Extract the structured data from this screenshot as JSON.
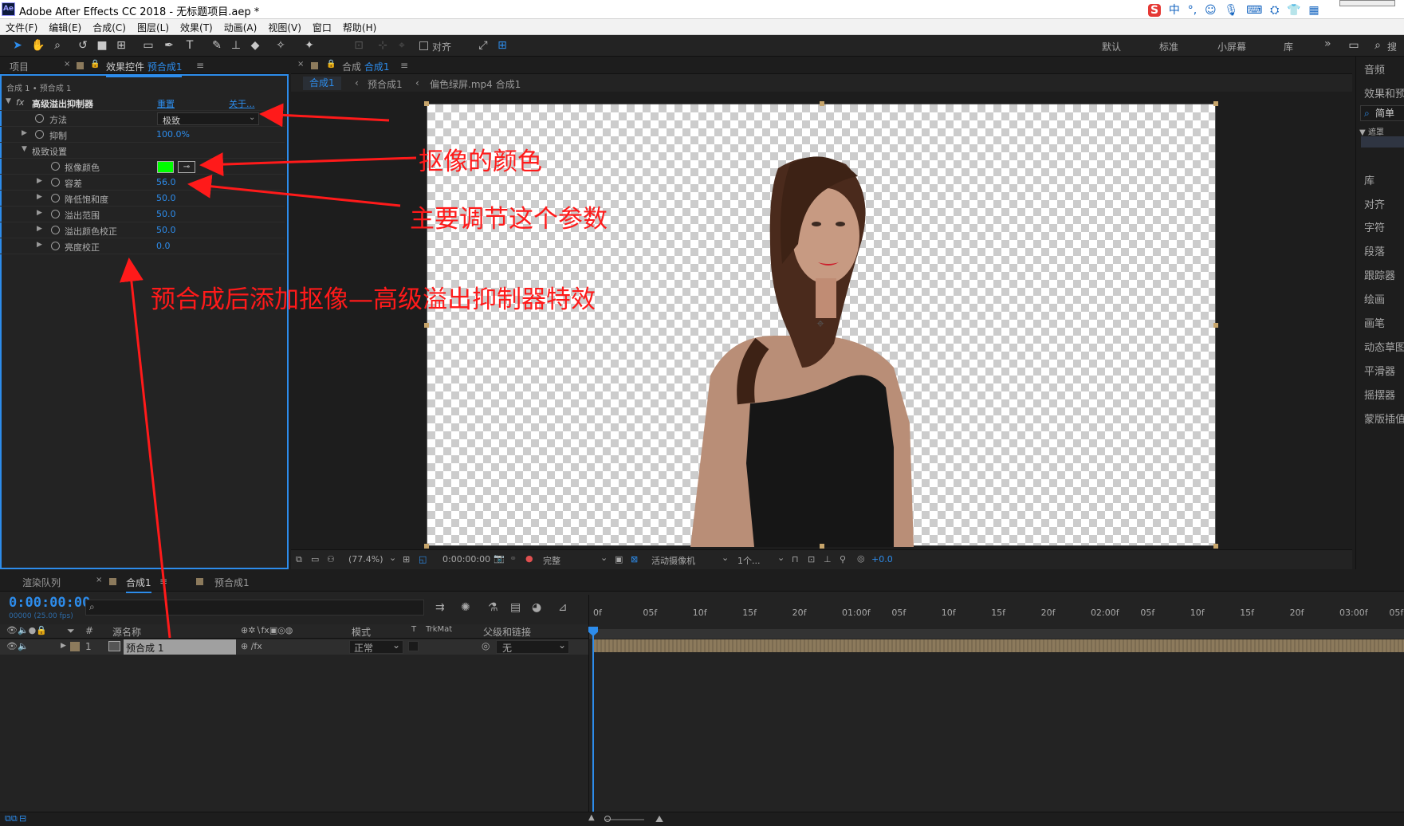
{
  "window": {
    "title": "Adobe After Effects CC 2018 - 无标题项目.aep *",
    "app_badge": "Ae"
  },
  "ime": {
    "logo": "S",
    "items": [
      "中",
      "°,",
      "☺",
      "🎙",
      "⌨",
      "⛭",
      "👕",
      "▦"
    ]
  },
  "menu": [
    "文件(F)",
    "编辑(E)",
    "合成(C)",
    "图层(L)",
    "效果(T)",
    "动画(A)",
    "视图(V)",
    "窗口",
    "帮助(H)"
  ],
  "toolbar": {
    "align_label": "对齐",
    "workspaces": [
      "默认",
      "标准",
      "小屏幕",
      "库"
    ],
    "overflow": "»",
    "search_partial": "搜"
  },
  "project_panel": {
    "tab_project": "项目",
    "tab_effect_controls": "效果控件",
    "effect_controls_target": "预合成1",
    "breadcrumb": "合成 1 • 预合成 1"
  },
  "effect": {
    "fx": "fx",
    "name": "高级溢出抑制器",
    "reset": "重置",
    "about": "关于...",
    "method_label": "方法",
    "method_value": "极致",
    "suppression_label": "抑制",
    "suppression_value": "100.0%",
    "ultra_settings_label": "极致设置",
    "key_color_label": "抠像颜色",
    "key_color": "#00ff00",
    "params": [
      {
        "label": "容差",
        "value": "56.0"
      },
      {
        "label": "降低饱和度",
        "value": "50.0"
      },
      {
        "label": "溢出范围",
        "value": "50.0"
      },
      {
        "label": "溢出颜色校正",
        "value": "50.0"
      },
      {
        "label": "亮度校正",
        "value": "0.0"
      }
    ]
  },
  "comp_panel": {
    "tab_comp_prefix": "合成",
    "tab_comp_name": "合成1",
    "flow": [
      "合成1",
      "预合成1",
      "偏色绿屏.mp4 合成1"
    ],
    "footer": {
      "zoom": "(77.4%)",
      "timecode": "0:00:00:00",
      "resolution": "完整",
      "camera": "活动摄像机",
      "views": "1个...",
      "exposure": "+0.0"
    }
  },
  "right_panel": {
    "items": [
      "音频",
      "效果和预设",
      "库",
      "对齐",
      "字符",
      "段落",
      "跟踪器",
      "绘画",
      "画笔",
      "动态草图",
      "平滑器",
      "摇摆器",
      "蒙版插值"
    ],
    "search": "简单",
    "tree_label": "遮罩"
  },
  "timeline": {
    "tab_render": "渲染队列",
    "tab_comp": "合成1",
    "tab_precomp": "预合成1",
    "timecode": "0:00:00:00",
    "frame_info": "00000 (25.00 fps)",
    "columns": {
      "num": "#",
      "source": "源名称",
      "mode": "模式",
      "t": "T",
      "trkmat": "TrkMat",
      "parent": "父级和链接"
    },
    "layers": [
      {
        "num": "1",
        "name": "预合成 1",
        "mode": "正常",
        "parent": "无"
      }
    ],
    "ruler": [
      "0f",
      "05f",
      "10f",
      "15f",
      "20f",
      "01:00f",
      "05f",
      "10f",
      "15f",
      "20f",
      "02:00f",
      "05f",
      "10f",
      "15f",
      "20f",
      "03:00f",
      "05f"
    ]
  },
  "annotations": {
    "key_color": "抠像的颜色",
    "tolerance": "主要调节这个参数",
    "precomp": "预合成后添加抠像—高级溢出抑制器特效"
  },
  "colors": {
    "accent": "#2d8ceb",
    "annotation": "#ff1a1a",
    "layer_bar": "#8c7a5c",
    "key_color": "#00ff00"
  }
}
